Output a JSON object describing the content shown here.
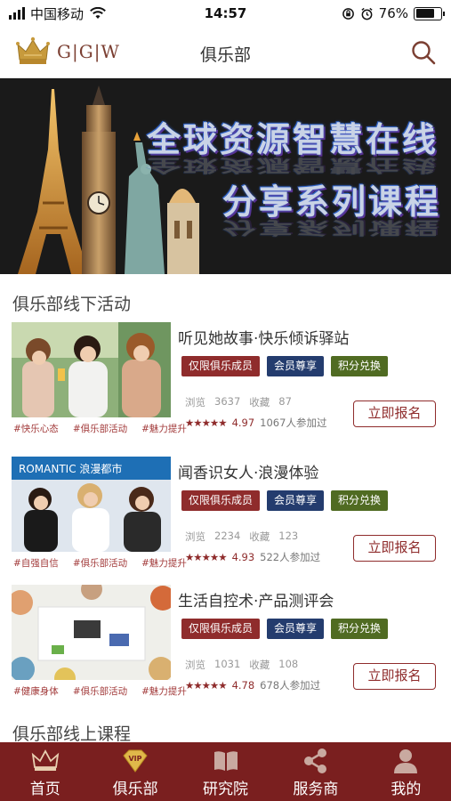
{
  "status_bar": {
    "carrier": "中国移动",
    "time": "14:57",
    "battery": "76%",
    "battery_level": 0.76
  },
  "header": {
    "logo_text": "G|G|W",
    "title": "俱乐部"
  },
  "banner": {
    "line1": "全球资源智慧在线",
    "line2": "分享系列课程"
  },
  "offline_section": {
    "title": "俱乐部线下活动"
  },
  "online_section": {
    "title": "俱乐部线上课程"
  },
  "activities": [
    {
      "title": "听见她故事·快乐倾诉驿站",
      "tags": [
        "#快乐心态",
        "#俱乐部活动",
        "#魅力提升"
      ],
      "badges": [
        "仅限俱乐成员",
        "会员尊享",
        "积分兑换"
      ],
      "views_label": "浏览",
      "views": "3637",
      "fav_label": "收藏",
      "favs": "87",
      "stars": "★★★★★",
      "score": "4.97",
      "participants": "1067人参加过",
      "button": "立即报名"
    },
    {
      "title": "闻香识女人·浪漫体验",
      "tags": [
        "#自强自信",
        "#俱乐部活动",
        "#魅力提升"
      ],
      "badges": [
        "仅限俱乐成员",
        "会员尊享",
        "积分兑换"
      ],
      "views_label": "浏览",
      "views": "2234",
      "fav_label": "收藏",
      "favs": "123",
      "stars": "★★★★★",
      "score": "4.93",
      "participants": "522人参加过",
      "button": "立即报名",
      "image_sign": "ROMANTIC 浪漫都市"
    },
    {
      "title": "生活自控术·产品测评会",
      "tags": [
        "#健康身体",
        "#俱乐部活动",
        "#魅力提升"
      ],
      "badges": [
        "仅限俱乐成员",
        "会员尊享",
        "积分兑换"
      ],
      "views_label": "浏览",
      "views": "1031",
      "fav_label": "收藏",
      "favs": "108",
      "stars": "★★★★★",
      "score": "4.78",
      "participants": "678人参加过",
      "button": "立即报名"
    }
  ],
  "tabbar": [
    {
      "label": "首页",
      "icon": "crown-icon"
    },
    {
      "label": "俱乐部",
      "icon": "vip-diamond-icon"
    },
    {
      "label": "研究院",
      "icon": "book-icon"
    },
    {
      "label": "服务商",
      "icon": "share-icon"
    },
    {
      "label": "我的",
      "icon": "user-icon"
    }
  ],
  "colors": {
    "brand": "#7a1f1f",
    "accent_red": "#8f2c2c",
    "badge_navy": "#243c6e",
    "badge_green": "#506b22",
    "vip_gold": "#e0b84a"
  }
}
